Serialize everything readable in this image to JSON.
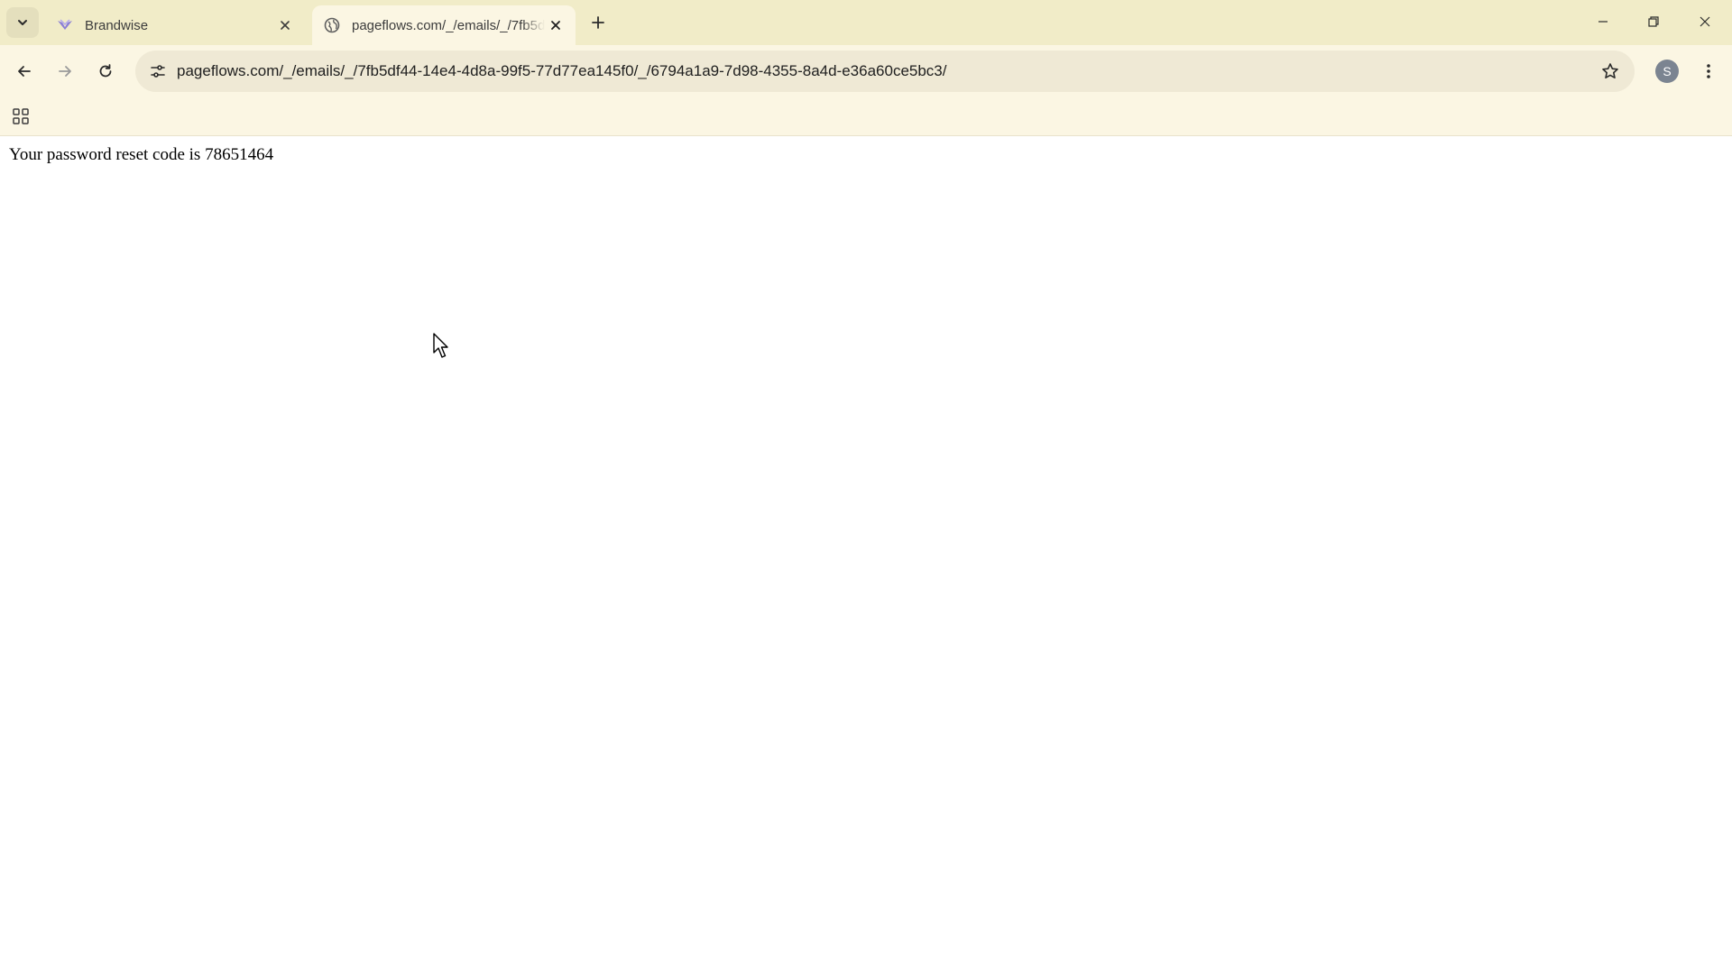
{
  "tabs": [
    {
      "title": "Brandwise",
      "favicon": "brandwise-logo-icon",
      "active": false
    },
    {
      "title": "pageflows.com/_/emails/_/7fb5df44-14e4-4d8a-99f5-77d77ea145f0/_/6794a1a9-7d98-4355-8a4d-e36a60ce5bc3/",
      "favicon": "globe-icon",
      "active": true
    }
  ],
  "toolbar": {
    "url": "pageflows.com/_/emails/_/7fb5df44-14e4-4d8a-99f5-77d77ea145f0/_/6794a1a9-7d98-4355-8a4d-e36a60ce5bc3/",
    "profile_initial": "S"
  },
  "page": {
    "message": "Your password reset code is 78651464"
  },
  "colors": {
    "tabstrip_bg": "#f1ecc8",
    "toolbar_bg": "#fbf6e3",
    "omnibox_bg": "#efe9d5",
    "brand_accent": "#8b7fd6"
  }
}
